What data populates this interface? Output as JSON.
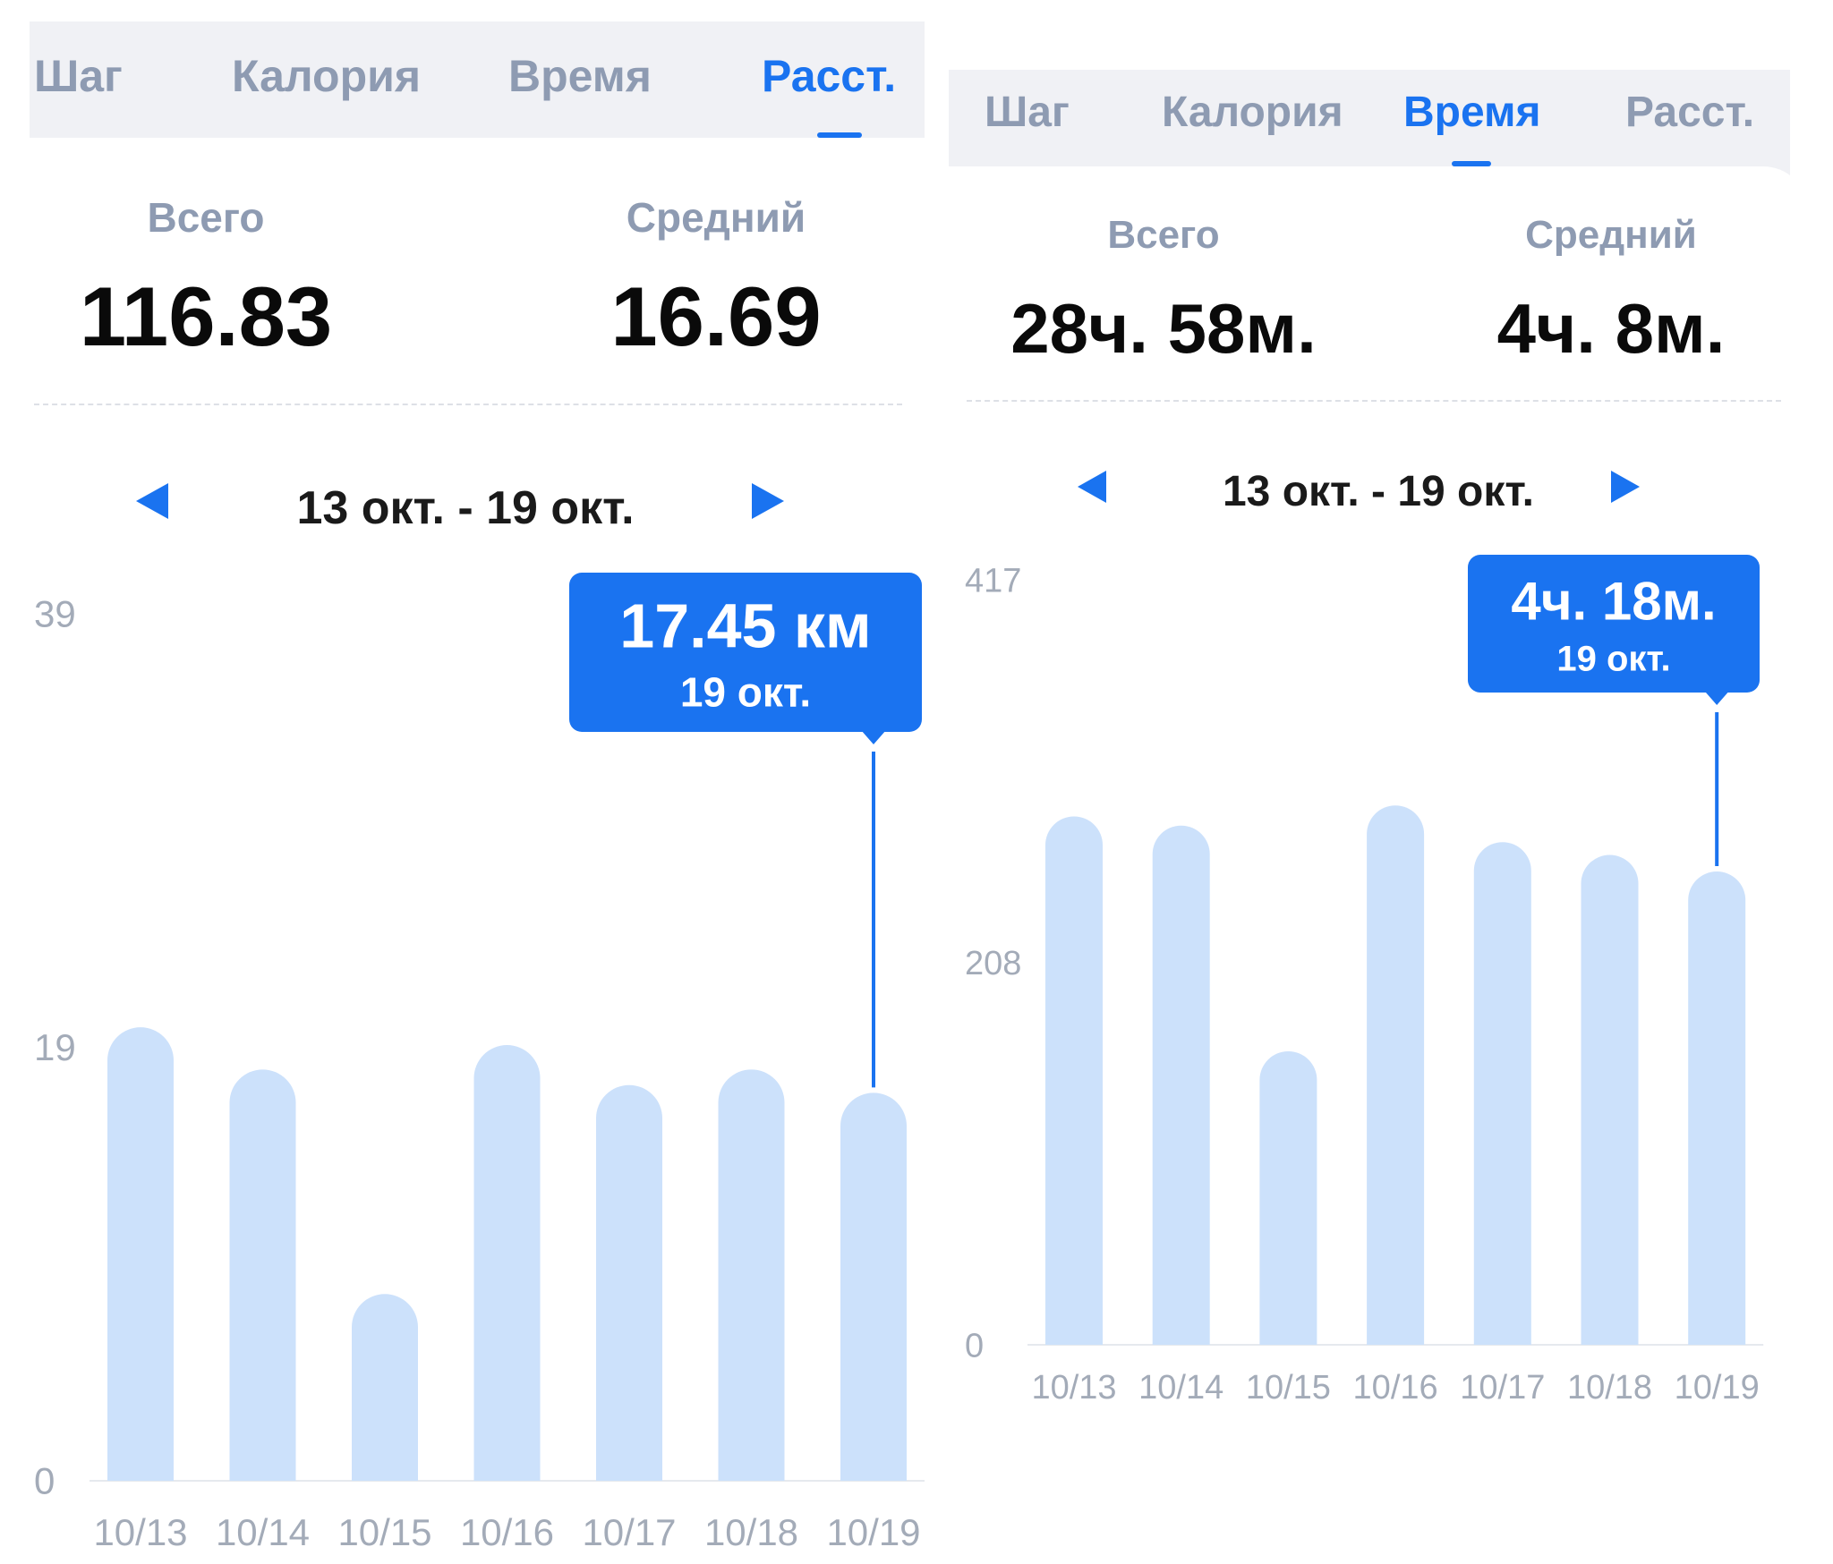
{
  "left": {
    "tabs": [
      {
        "label": "Шаг",
        "active": false
      },
      {
        "label": "Калория",
        "active": false
      },
      {
        "label": "Время",
        "active": false
      },
      {
        "label": "Расст.",
        "active": true
      }
    ],
    "stats": {
      "total_label": "Всего",
      "total_value": "116.83",
      "average_label": "Средний",
      "average_value": "16.69"
    },
    "date_range": "13 окт. - 19 окт.",
    "prev_icon": "triangle-left-icon",
    "next_icon": "triangle-right-icon",
    "tooltip": {
      "value": "17.45 км",
      "date": "19 окт.",
      "index": 6
    },
    "colors": {
      "accent": "#1a73f0",
      "bar": "#cce1fb",
      "tab_inactive": "#8e9bb2"
    },
    "chart_data": {
      "type": "bar",
      "categories": [
        "10/13",
        "10/14",
        "10/15",
        "10/16",
        "10/17",
        "10/18",
        "10/19"
      ],
      "values": [
        20.4,
        18.5,
        8.4,
        19.6,
        17.8,
        18.5,
        17.45
      ],
      "y_ticks": [
        "39",
        "19",
        "0"
      ],
      "ylim": [
        0,
        39
      ],
      "grid": false
    }
  },
  "right": {
    "tabs": [
      {
        "label": "Шаг",
        "active": false
      },
      {
        "label": "Калория",
        "active": false
      },
      {
        "label": "Время",
        "active": true
      },
      {
        "label": "Расст.",
        "active": false
      }
    ],
    "stats": {
      "total_label": "Всего",
      "total_value": "28ч. 58м.",
      "average_label": "Средний",
      "average_value": "4ч. 8м."
    },
    "date_range": "13 окт. - 19 окт.",
    "prev_icon": "triangle-left-icon",
    "next_icon": "triangle-right-icon",
    "tooltip": {
      "value": "4ч. 18м.",
      "date": "19 окт.",
      "index": 6
    },
    "colors": {
      "accent": "#1a73f0",
      "bar": "#cce1fb",
      "tab_inactive": "#8e9bb2"
    },
    "chart_data": {
      "type": "bar",
      "categories": [
        "10/13",
        "10/14",
        "10/15",
        "10/16",
        "10/17",
        "10/18",
        "10/19"
      ],
      "values": [
        288,
        283,
        160,
        294,
        274,
        267,
        258
      ],
      "y_ticks": [
        "417",
        "208",
        "0"
      ],
      "ylim": [
        0,
        417
      ],
      "grid": false
    }
  }
}
